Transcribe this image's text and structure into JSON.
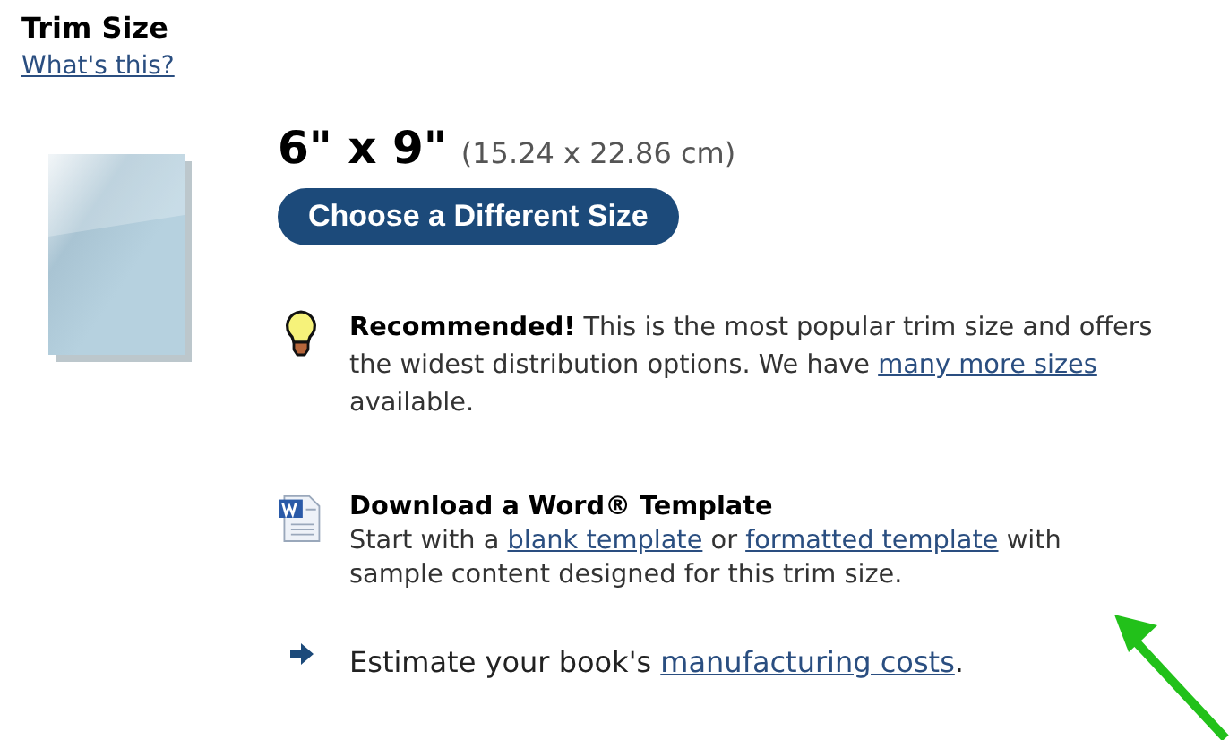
{
  "header": {
    "title": "Trim Size",
    "help_link": "What's this?"
  },
  "size": {
    "name": "6\" x 9\"",
    "metric": "(15.24 x 22.86 cm)",
    "button": "Choose a Different Size"
  },
  "notes": [
    {
      "kind": "tip",
      "segments": [
        {
          "kind": "bold",
          "text": "Recommended!"
        },
        {
          "kind": "text",
          "text": " This is the most popular trim size and offers the widest distribution options. We have "
        },
        {
          "kind": "link",
          "text": "many more sizes"
        },
        {
          "kind": "text",
          "text": " available."
        }
      ]
    },
    {
      "kind": "word",
      "title": "Download a Word® Template",
      "segments": [
        {
          "kind": "text",
          "text": "Start with a "
        },
        {
          "kind": "link",
          "text": "blank template"
        },
        {
          "kind": "text",
          "text": " or "
        },
        {
          "kind": "link",
          "text": "formatted template"
        },
        {
          "kind": "text",
          "text": " with sample content designed for this trim size."
        }
      ]
    },
    {
      "kind": "arrow",
      "segments": [
        {
          "kind": "text",
          "text": "Estimate your book's "
        },
        {
          "kind": "link",
          "text": "manufacturing costs"
        },
        {
          "kind": "text",
          "text": "."
        }
      ]
    }
  ]
}
